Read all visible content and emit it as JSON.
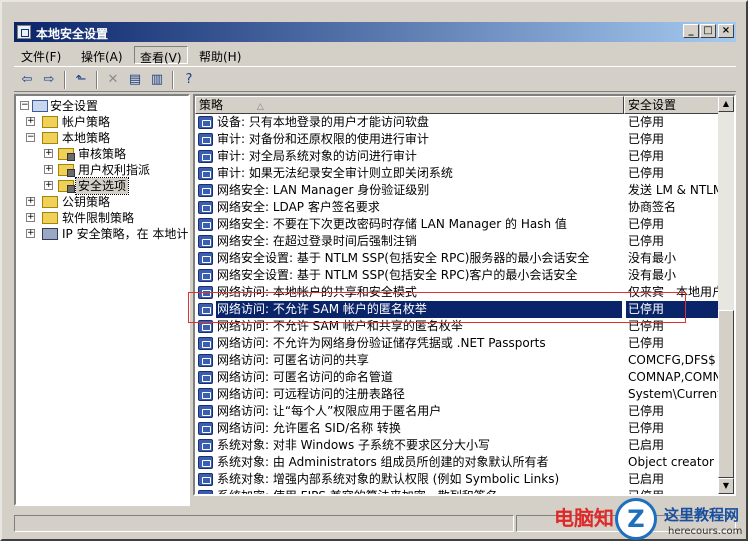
{
  "window": {
    "title": "本地安全设置"
  },
  "menu": [
    "文件(F)",
    "操作(A)",
    "查看(V)",
    "帮助(H)"
  ],
  "tree": [
    {
      "label": "安全设置",
      "icon": "computer-icon"
    },
    {
      "label": "帐户策略",
      "icon": "folder-icon"
    },
    {
      "label": "本地策略",
      "icon": "folder-icon"
    },
    {
      "label": "审核策略",
      "icon": "folder-icon"
    },
    {
      "label": "用户权利指派",
      "icon": "folder-icon"
    },
    {
      "label": "安全选项",
      "icon": "folder-icon"
    },
    {
      "label": "公钥策略",
      "icon": "folder-icon"
    },
    {
      "label": "软件限制策略",
      "icon": "folder-icon"
    },
    {
      "label": "IP 安全策略，在 本地计",
      "icon": "network-policy-icon"
    }
  ],
  "list": {
    "col_policy": "策略",
    "sort_glyph": "△",
    "col_setting": "安全设置",
    "rows": [
      {
        "name": "设备: 只有本地登录的用户才能访问软盘",
        "value": "已停用"
      },
      {
        "name": "审计: 对备份和还原权限的使用进行审计",
        "value": "已停用"
      },
      {
        "name": "审计: 对全局系统对象的访问进行审计",
        "value": "已停用"
      },
      {
        "name": "审计: 如果无法纪录安全审计则立即关闭系统",
        "value": "已停用"
      },
      {
        "name": "网络安全: LAN Manager 身份验证级别",
        "value": "发送 LM & NTLM 响应"
      },
      {
        "name": "网络安全: LDAP 客户签名要求",
        "value": "协商签名"
      },
      {
        "name": "网络安全: 不要在下次更改密码时存储 LAN Manager 的 Hash 值",
        "value": "已停用"
      },
      {
        "name": "网络安全: 在超过登录时间后强制注销",
        "value": "已停用"
      },
      {
        "name": "网络安全设置: 基于 NTLM SSP(包括安全 RPC)服务器的最小会话安全",
        "value": "没有最小"
      },
      {
        "name": "网络安全设置: 基于 NTLM SSP(包括安全 RPC)客户的最小会话安全",
        "value": "没有最小"
      },
      {
        "name": "网络访问: 本地帐户的共享和安全模式",
        "value": "仅来宾 - 本地用户以来宾身份验证"
      },
      {
        "name": "网络访问: 不允许 SAM 帐户的匿名枚举",
        "value": "已停用"
      },
      {
        "name": "网络访问: 不允许 SAM 帐户和共享的匿名枚举",
        "value": "已停用"
      },
      {
        "name": "网络访问: 不允许为网络身份验证储存凭据或 .NET Passports",
        "value": "已停用"
      },
      {
        "name": "网络访问: 可匿名访问的共享",
        "value": "COMCFG,DFS$"
      },
      {
        "name": "网络访问: 可匿名访问的命名管道",
        "value": "COMNAP,COMNODE,SQL\\QUERY"
      },
      {
        "name": "网络访问: 可远程访问的注册表路径",
        "value": "System\\CurrentControlSet"
      },
      {
        "name": "网络访问: 让“每个人”权限应用于匿名用户",
        "value": "已停用"
      },
      {
        "name": "网络访问: 允许匿名 SID/名称 转换",
        "value": "已停用"
      },
      {
        "name": "系统对象: 对非 Windows 子系统不要求区分大小写",
        "value": "已启用"
      },
      {
        "name": "系统对象: 由 Administrators 组成员所创建的对象默认所有者",
        "value": "Object creator"
      },
      {
        "name": "系统对象: 增强内部系统对象的默认权限 (例如 Symbolic Links)",
        "value": "已启用"
      },
      {
        "name": "系统加密: 使用 FIPS 兼容的算法来加密，散列和签名",
        "value": "已停用"
      }
    ]
  },
  "watermark": {
    "text": "电脑知",
    "logo_letter": "Z",
    "site_name": "这里教程网",
    "url": "herecours.com"
  }
}
